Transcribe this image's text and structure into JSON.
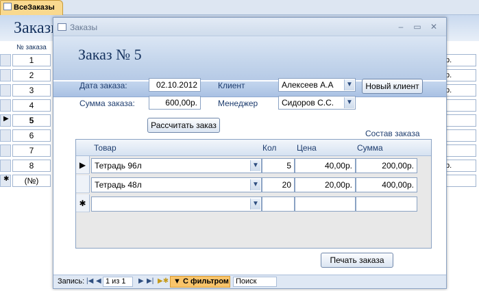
{
  "tab": {
    "label": "ВсеЗаказы"
  },
  "background_form": {
    "title": "Заказы",
    "column_header": "№ заказа",
    "rows": [
      "1",
      "2",
      "3",
      "4",
      "5",
      "6",
      "7",
      "8",
      "(№)"
    ],
    "right_col": [
      "р.",
      "р.",
      "р.",
      "",
      "",
      "",
      "",
      "р.",
      ""
    ]
  },
  "dialog": {
    "window_title": "Заказы",
    "header_title": "Заказ № 5",
    "labels": {
      "date": "Дата заказа:",
      "sum": "Сумма заказа:",
      "client": "Клиент",
      "manager": "Менеджер",
      "composition": "Состав заказа"
    },
    "fields": {
      "date": "02.10.2012",
      "sum": "600,00р.",
      "client": "Алексеев А.А",
      "manager": "Сидоров С.С."
    },
    "buttons": {
      "new_client": "Новый клиент",
      "calculate": "Рассчитать заказ",
      "print": "Печать заказа"
    },
    "subform": {
      "columns": [
        "Товар",
        "Кол",
        "Цена",
        "Сумма"
      ],
      "rows": [
        {
          "product": "Тетрадь 96л",
          "qty": "5",
          "price": "40,00р.",
          "sum": "200,00р."
        },
        {
          "product": "Тетрадь 48л",
          "qty": "20",
          "price": "20,00р.",
          "sum": "400,00р."
        }
      ]
    },
    "navigation": {
      "label": "Запись:",
      "position": "1 из 1",
      "filter": "С фильтром",
      "search": "Поиск"
    }
  }
}
